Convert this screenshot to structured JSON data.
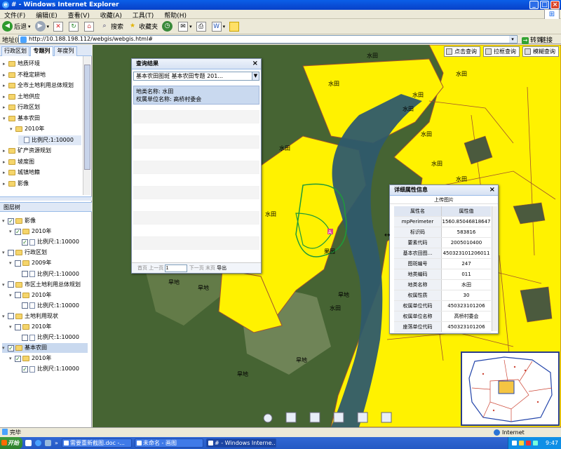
{
  "window": {
    "title": "# - Windows Internet Explorer"
  },
  "menu": [
    "文件(F)",
    "编辑(E)",
    "查看(V)",
    "收藏(A)",
    "工具(T)",
    "帮助(H)"
  ],
  "toolbar": {
    "back": "后退",
    "search": "搜索",
    "favorites": "收藏夹"
  },
  "address": {
    "label": "地址(D)",
    "url": "http://10.188.198.112/webgis/webgis.html#",
    "go": "转到",
    "links": "链接"
  },
  "left_tabs": [
    "行政区划",
    "专题列",
    "年度列"
  ],
  "topic_tree": [
    {
      "label": "地质环境",
      "expanded": false
    },
    {
      "label": "不稳定耕地",
      "expanded": false
    },
    {
      "label": "全市土地利用总体规划",
      "expanded": false
    },
    {
      "label": "土地供应",
      "expanded": false
    },
    {
      "label": "行政区划",
      "expanded": false
    },
    {
      "label": "基本农田",
      "expanded": true
    },
    {
      "label": "2010年",
      "expanded": true
    },
    {
      "label": "比例尺:1:10000",
      "leaf": true
    },
    {
      "label": "矿产资源规划",
      "expanded": false
    },
    {
      "label": "坡度图",
      "expanded": false
    },
    {
      "label": "城镇地籍",
      "expanded": false
    },
    {
      "label": "影像",
      "expanded": false
    }
  ],
  "layer_tree_title": "图层树",
  "layer_tree": [
    {
      "label": "影像",
      "checked": true
    },
    {
      "label": "2010年",
      "checked": true
    },
    {
      "label": "比例尺:1:10000",
      "checked": true
    },
    {
      "label": "行政区划",
      "checked": false
    },
    {
      "label": "2009年",
      "checked": false
    },
    {
      "label": "比例尺:1:10000",
      "checked": false
    },
    {
      "label": "市区土地利用总体规划",
      "checked": false
    },
    {
      "label": "2010年",
      "checked": false
    },
    {
      "label": "比例尺:1:10000",
      "checked": false
    },
    {
      "label": "土地利用现状",
      "checked": false
    },
    {
      "label": "2010年",
      "checked": false
    },
    {
      "label": "比例尺:1:10000",
      "checked": false
    },
    {
      "label": "基本农田",
      "checked": true
    },
    {
      "label": "2010年",
      "checked": true
    },
    {
      "label": "比例尺:1:10000",
      "checked": true
    }
  ],
  "map_tools": [
    "点击查询",
    "拉框查询",
    "模糊查询"
  ],
  "query_panel": {
    "title": "查询结果",
    "dropdown": "基本农田图斑 基本农田专题 201...",
    "result_line1": "地类名称: 水田",
    "result_line2": "权属单位名称: 高桥村委会",
    "pager": {
      "first": "首页",
      "prev": "上一页",
      "page": "1",
      "next": "下一页",
      "last": "末页",
      "export": "导出"
    }
  },
  "detail_panel": {
    "title": "详细属性信息",
    "upload": "上传图片",
    "col_name": "属性名",
    "col_value": "属性值",
    "rows": [
      {
        "k": "mpPerimeter",
        "v": "1560.85046818647"
      },
      {
        "k": "标识码",
        "v": "583816"
      },
      {
        "k": "要素代码",
        "v": "2005010400"
      },
      {
        "k": "基本农田图...",
        "v": "450323101206011"
      },
      {
        "k": "图斑编号",
        "v": "247"
      },
      {
        "k": "地类编码",
        "v": "011"
      },
      {
        "k": "地类名称",
        "v": "水田"
      },
      {
        "k": "权属性质",
        "v": "30"
      },
      {
        "k": "权属单位代码",
        "v": "450323101206"
      },
      {
        "k": "权属单位名称",
        "v": "高桥村委会"
      },
      {
        "k": "座落单位代码",
        "v": "450323101206"
      }
    ]
  },
  "map_labels": [
    "水田",
    "水田",
    "水田",
    "水田",
    "水田",
    "水田",
    "水田",
    "水田",
    "水田",
    "水田",
    "水田",
    "水田",
    "水田",
    "水田",
    "水田",
    "水田",
    "水田",
    "水田",
    "水田",
    "水田",
    "水田",
    "水田",
    "水田",
    "水田",
    "水田",
    "水田",
    "旱地",
    "旱地",
    "旱地",
    "旱地",
    "旱地",
    "旱地",
    "旱地",
    "果园",
    "果园",
    "果园"
  ],
  "status": {
    "left": "完毕",
    "zone": "Internet"
  },
  "taskbar": {
    "start": "开始",
    "items": [
      "需要重新截图.doc -...",
      "未命名 - 画图",
      "# - Windows Interne..."
    ],
    "time": "9:47"
  },
  "colors": {
    "titlebar": "#0a5fe8",
    "land_parcel": "#fff200",
    "river": "#2f5a6b",
    "panel_header": "#dfe8f6",
    "selected_row": "#c9d9ef"
  }
}
